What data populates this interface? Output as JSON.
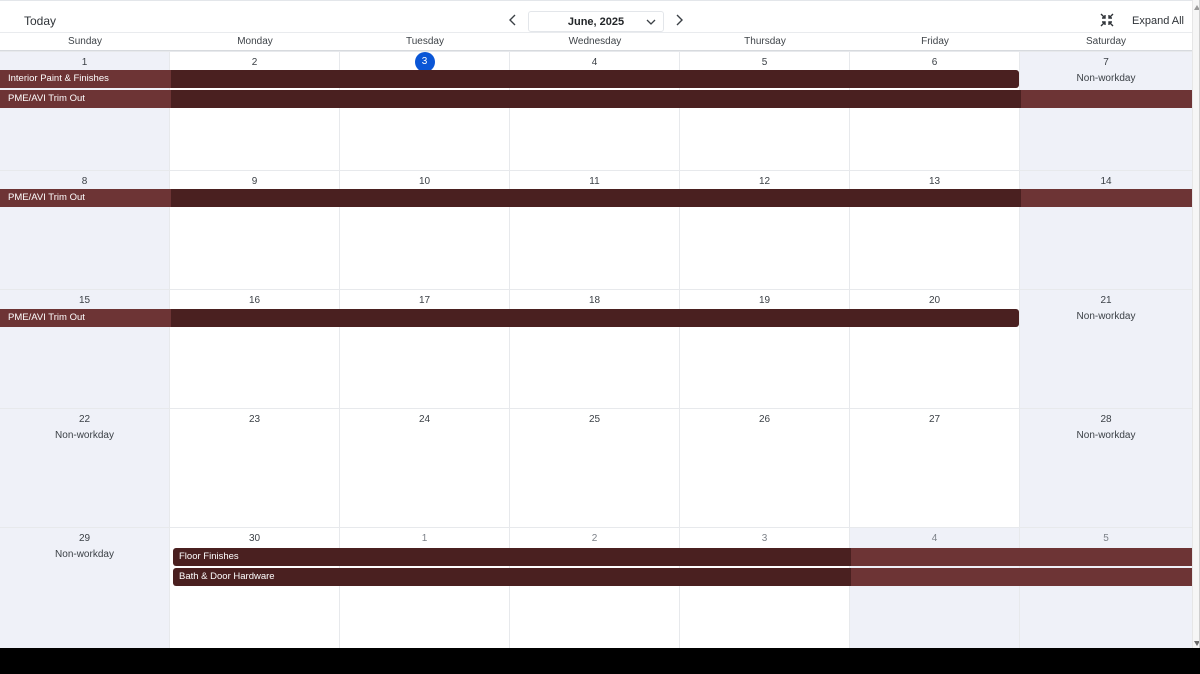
{
  "toolbar": {
    "today_label": "Today",
    "month_label": "June, 2025",
    "expand_all_label": "Expand All"
  },
  "weekdays": [
    "Sunday",
    "Monday",
    "Tuesday",
    "Wednesday",
    "Thursday",
    "Friday",
    "Saturday"
  ],
  "weeks": [
    {
      "days": [
        {
          "num": "1",
          "nonworkday": ""
        },
        {
          "num": "2",
          "nonworkday": ""
        },
        {
          "num": "3",
          "nonworkday": "",
          "today": true
        },
        {
          "num": "4",
          "nonworkday": ""
        },
        {
          "num": "5",
          "nonworkday": ""
        },
        {
          "num": "6",
          "nonworkday": ""
        },
        {
          "num": "7",
          "nonworkday": "Non-workday"
        }
      ]
    },
    {
      "days": [
        {
          "num": "8",
          "nonworkday": ""
        },
        {
          "num": "9",
          "nonworkday": ""
        },
        {
          "num": "10",
          "nonworkday": ""
        },
        {
          "num": "11",
          "nonworkday": ""
        },
        {
          "num": "12",
          "nonworkday": ""
        },
        {
          "num": "13",
          "nonworkday": ""
        },
        {
          "num": "14",
          "nonworkday": ""
        }
      ]
    },
    {
      "days": [
        {
          "num": "15",
          "nonworkday": ""
        },
        {
          "num": "16",
          "nonworkday": ""
        },
        {
          "num": "17",
          "nonworkday": ""
        },
        {
          "num": "18",
          "nonworkday": ""
        },
        {
          "num": "19",
          "nonworkday": ""
        },
        {
          "num": "20",
          "nonworkday": ""
        },
        {
          "num": "21",
          "nonworkday": "Non-workday"
        }
      ]
    },
    {
      "days": [
        {
          "num": "22",
          "nonworkday": "Non-workday"
        },
        {
          "num": "23",
          "nonworkday": ""
        },
        {
          "num": "24",
          "nonworkday": ""
        },
        {
          "num": "25",
          "nonworkday": ""
        },
        {
          "num": "26",
          "nonworkday": ""
        },
        {
          "num": "27",
          "nonworkday": ""
        },
        {
          "num": "28",
          "nonworkday": "Non-workday"
        }
      ]
    },
    {
      "days": [
        {
          "num": "29",
          "nonworkday": "Non-workday"
        },
        {
          "num": "30",
          "nonworkday": ""
        },
        {
          "num": "1",
          "nonworkday": "",
          "outside": true
        },
        {
          "num": "2",
          "nonworkday": "",
          "outside": true
        },
        {
          "num": "3",
          "nonworkday": "",
          "outside": true
        },
        {
          "num": "4",
          "nonworkday": "",
          "outside": true
        },
        {
          "num": "5",
          "nonworkday": "",
          "outside": true
        }
      ]
    }
  ],
  "events": {
    "interior_paint": "Interior Paint & Finishes",
    "pme_trim_w1": "PME/AVI Trim Out",
    "pme_trim_w2": "PME/AVI Trim Out",
    "pme_trim_w3": "PME/AVI Trim Out",
    "floor_finishes": "Floor Finishes",
    "bath_door_hardware": "Bath & Door Hardware"
  },
  "colors": {
    "event_dark": "#4a2020",
    "event_light": "#6d3435",
    "today_circle": "#0a56d6",
    "weekend_shade": "#eff1f8"
  },
  "icons": {
    "prev": "chevron-left-icon",
    "next": "chevron-right-icon",
    "dropdown": "chevron-down-icon",
    "collapse": "collapse-arrows-icon"
  }
}
